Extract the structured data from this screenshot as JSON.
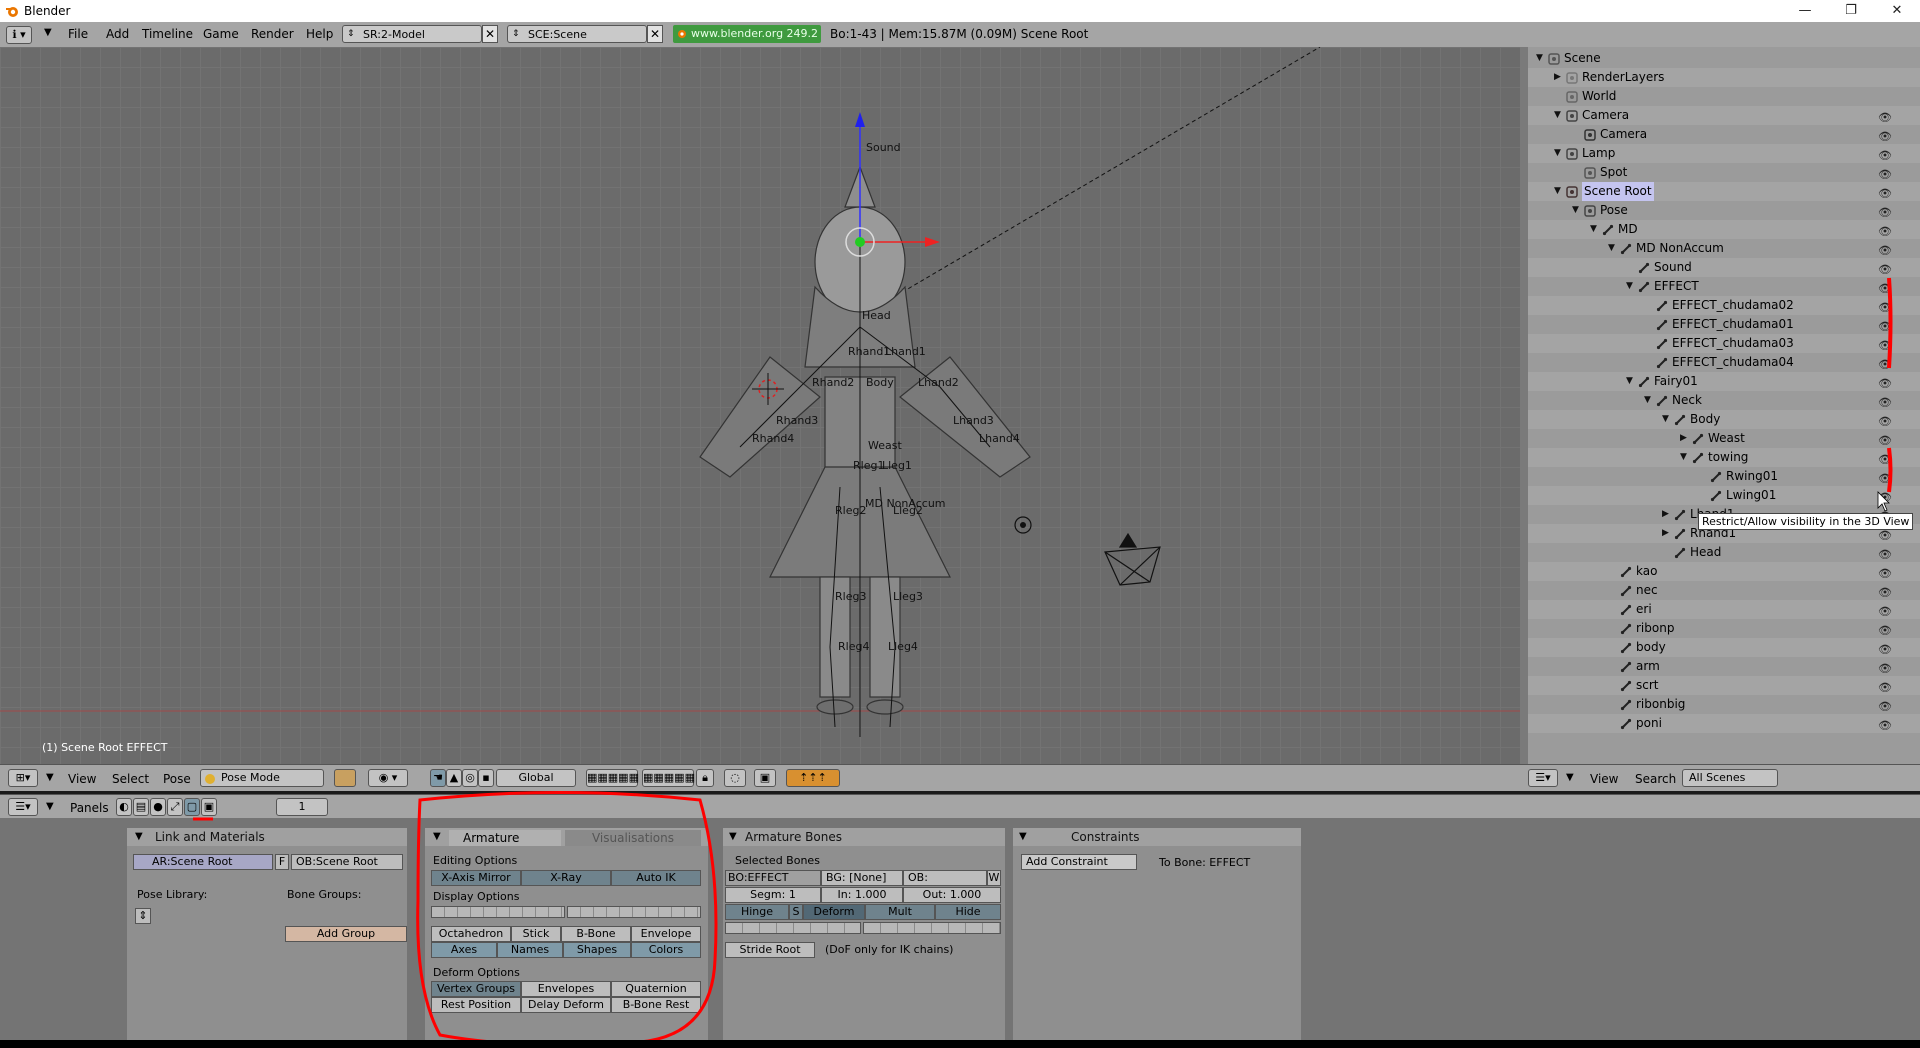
{
  "window": {
    "title": "Blender",
    "minimize": "—",
    "restore": "❐",
    "close": "✕"
  },
  "menu": {
    "items": [
      "File",
      "Add",
      "Timeline",
      "Game",
      "Render",
      "Help"
    ],
    "screen_field": "SR:2-Model",
    "scene_field": "SCE:Scene",
    "url": "www.blender.org 249.2",
    "stats": "Bo:1-43  |  Mem:15.87M (0.09M) Scene Root"
  },
  "viewport": {
    "status_text": "(1) Scene Root EFFECT",
    "labels": [
      "Sound",
      "Head",
      "Rhand1",
      "Lhand1",
      "Rhand2",
      "Lhand2",
      "Rhand3",
      "Lhand3",
      "Rhand4",
      "Lhand4",
      "Body",
      "Weast",
      "Rleg1",
      "Lleg1",
      "MD NonAccum",
      "Rleg2",
      "Lleg2",
      "Rleg3",
      "Lleg3",
      "Rleg4",
      "Lleg4"
    ]
  },
  "vp_header": {
    "view": "View",
    "select": "Select",
    "pose": "Pose",
    "mode": "Pose Mode",
    "orientation": "Global"
  },
  "outliner": {
    "rows": [
      {
        "label": "Scene",
        "indent": 0,
        "tri": "▼",
        "icon": "scene"
      },
      {
        "label": "RenderLayers",
        "indent": 1,
        "tri": "▶",
        "icon": "renderlayers"
      },
      {
        "label": "World",
        "indent": 1,
        "tri": "",
        "icon": "world"
      },
      {
        "label": "Camera",
        "indent": 1,
        "tri": "▼",
        "icon": "object"
      },
      {
        "label": "Camera",
        "indent": 2,
        "tri": "",
        "icon": "camera"
      },
      {
        "label": "Lamp",
        "indent": 1,
        "tri": "▼",
        "icon": "object"
      },
      {
        "label": "Spot",
        "indent": 2,
        "tri": "",
        "icon": "lamp"
      },
      {
        "label": "Scene Root",
        "indent": 1,
        "tri": "▼",
        "icon": "armature"
      },
      {
        "label": "Pose",
        "indent": 2,
        "tri": "▼",
        "icon": "pose"
      },
      {
        "label": "MD",
        "indent": 3,
        "tri": "▼",
        "icon": "bone"
      },
      {
        "label": "MD NonAccum",
        "indent": 4,
        "tri": "▼",
        "icon": "bone"
      },
      {
        "label": "Sound",
        "indent": 5,
        "tri": "",
        "icon": "bone"
      },
      {
        "label": "EFFECT",
        "indent": 5,
        "tri": "▼",
        "icon": "bone"
      },
      {
        "label": "EFFECT_chudama02",
        "indent": 6,
        "tri": "",
        "icon": "bone"
      },
      {
        "label": "EFFECT_chudama01",
        "indent": 6,
        "tri": "",
        "icon": "bone"
      },
      {
        "label": "EFFECT_chudama03",
        "indent": 6,
        "tri": "",
        "icon": "bone"
      },
      {
        "label": "EFFECT_chudama04",
        "indent": 6,
        "tri": "",
        "icon": "bone"
      },
      {
        "label": "Fairy01",
        "indent": 5,
        "tri": "▼",
        "icon": "bone"
      },
      {
        "label": "Neck",
        "indent": 6,
        "tri": "▼",
        "icon": "bone"
      },
      {
        "label": "Body",
        "indent": 7,
        "tri": "▼",
        "icon": "bone"
      },
      {
        "label": "Weast",
        "indent": 8,
        "tri": "▶",
        "icon": "bone"
      },
      {
        "label": "towing",
        "indent": 8,
        "tri": "▼",
        "icon": "bone"
      },
      {
        "label": "Rwing01",
        "indent": 9,
        "tri": "",
        "icon": "bone"
      },
      {
        "label": "Lwing01",
        "indent": 9,
        "tri": "",
        "icon": "bone"
      },
      {
        "label": "Lhand1",
        "indent": 7,
        "tri": "▶",
        "icon": "bone"
      },
      {
        "label": "Rhand1",
        "indent": 7,
        "tri": "▶",
        "icon": "bone"
      },
      {
        "label": "Head",
        "indent": 7,
        "tri": "",
        "icon": "bone"
      },
      {
        "label": "kao",
        "indent": 4,
        "tri": "",
        "icon": "bone"
      },
      {
        "label": "nec",
        "indent": 4,
        "tri": "",
        "icon": "bone"
      },
      {
        "label": "eri",
        "indent": 4,
        "tri": "",
        "icon": "bone"
      },
      {
        "label": "ribonp",
        "indent": 4,
        "tri": "",
        "icon": "bone"
      },
      {
        "label": "body",
        "indent": 4,
        "tri": "",
        "icon": "bone"
      },
      {
        "label": "arm",
        "indent": 4,
        "tri": "",
        "icon": "bone"
      },
      {
        "label": "scrt",
        "indent": 4,
        "tri": "",
        "icon": "bone"
      },
      {
        "label": "ribonbig",
        "indent": 4,
        "tri": "",
        "icon": "bone"
      },
      {
        "label": "poni",
        "indent": 4,
        "tri": "",
        "icon": "bone"
      }
    ],
    "tooltip": "Restrict/Allow visibility in the 3D View",
    "header_view": "View",
    "header_search": "Search",
    "scenes_select": "All Scenes"
  },
  "buttons_header": {
    "panels": "Panels",
    "frame": "1"
  },
  "link_materials": {
    "title": "Link and Materials",
    "ar_field": "AR:Scene Root",
    "f_btn": "F",
    "ob_field": "OB:Scene Root",
    "pose_library": "Pose Library:",
    "bone_groups": "Bone Groups:",
    "add_group": "Add Group"
  },
  "armature": {
    "tab_armature": "Armature",
    "tab_vis": "Visualisations",
    "editing_options": "Editing Options",
    "xaxis_mirror": "X-Axis Mirror",
    "xray": "X-Ray",
    "auto_ik": "Auto IK",
    "display_options": "Display Options",
    "octahedron": "Octahedron",
    "stick": "Stick",
    "bbone": "B-Bone",
    "envelope": "Envelope",
    "axes": "Axes",
    "names": "Names",
    "shapes": "Shapes",
    "colors": "Colors",
    "deform_options": "Deform Options",
    "vertex_groups": "Vertex Groups",
    "envelopes": "Envelopes",
    "quaternion": "Quaternion",
    "rest_position": "Rest Position",
    "delay_deform": "Delay Deform",
    "bbone_rest": "B-Bone Rest"
  },
  "armature_bones": {
    "title": "Armature Bones",
    "selected": "Selected Bones",
    "bo_field": "BO:EFFECT",
    "bg_field": "BG: [None]",
    "ob_field": "OB:",
    "w_btn": "W",
    "segm": "Segm: 1",
    "in_val": "In: 1.000",
    "out_val": "Out: 1.000",
    "hinge": "Hinge",
    "s_btn": "S",
    "deform": "Deform",
    "mult": "Mult",
    "hide": "Hide",
    "stride_root": "Stride Root",
    "dof_note": "(DoF only for IK chains)"
  },
  "constraints": {
    "title": "Constraints",
    "add_constraint": "Add Constraint",
    "to_bone": "To Bone: EFFECT"
  },
  "colors": {
    "annotation_red": "#ff0000",
    "url_green": "#3f9a3f",
    "viewport_bg": "#6b6b6b"
  }
}
